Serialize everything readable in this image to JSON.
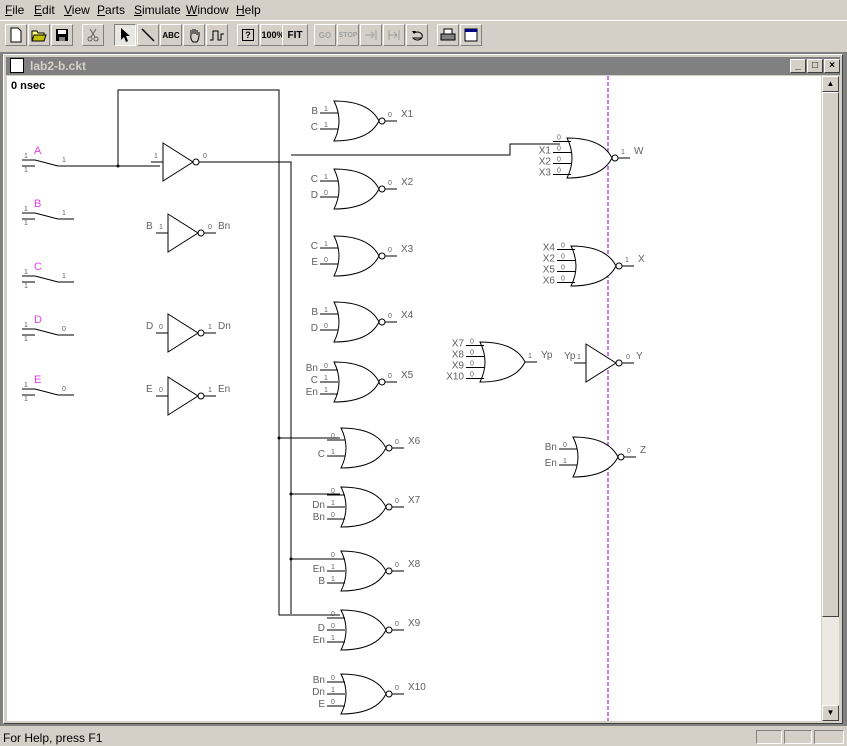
{
  "menu": {
    "file": "File",
    "edit": "Edit",
    "view": "View",
    "parts": "Parts",
    "simulate": "Simulate",
    "window": "Window",
    "help": "Help"
  },
  "toolbar": {
    "abc": "ABC",
    "q": "?",
    "zoom": "100%",
    "fit": "FIT",
    "go": "GO",
    "stop": "STOP"
  },
  "window": {
    "title": "lab2-b.ckt",
    "minimize": "_",
    "maximize": "□",
    "close": "×"
  },
  "time": "0 nsec",
  "status": {
    "text": "For Help, press F1"
  },
  "switches": [
    {
      "name": "A",
      "state": "1",
      "inbit": "1",
      "outbit": "1"
    },
    {
      "name": "B",
      "state": "1",
      "inbit": "1",
      "outbit": "1"
    },
    {
      "name": "C",
      "state": "1",
      "inbit": "1",
      "outbit": "1"
    },
    {
      "name": "D",
      "state": "1",
      "inbit": "1",
      "outbit": "0"
    },
    {
      "name": "E",
      "state": "1",
      "inbit": "1",
      "outbit": "0"
    }
  ],
  "inverters": [
    {
      "in": "",
      "inbit": "1",
      "out": "",
      "outbit": "0"
    },
    {
      "in": "B",
      "inbit": "1",
      "out": "Bn",
      "outbit": "0"
    },
    {
      "in": "D",
      "inbit": "0",
      "out": "Dn",
      "outbit": "1"
    },
    {
      "in": "E",
      "inbit": "0",
      "out": "En",
      "outbit": "1"
    },
    {
      "in": "Yp",
      "inbit": "1",
      "out": "Y",
      "outbit": "0"
    }
  ],
  "gates": [
    {
      "out": "X1",
      "outbit": "0",
      "ins": [
        {
          "n": "B",
          "b": "1"
        },
        {
          "n": "C",
          "b": "1"
        }
      ]
    },
    {
      "out": "X2",
      "outbit": "0",
      "ins": [
        {
          "n": "C",
          "b": "1"
        },
        {
          "n": "D",
          "b": "0"
        }
      ]
    },
    {
      "out": "X3",
      "outbit": "0",
      "ins": [
        {
          "n": "C",
          "b": "1"
        },
        {
          "n": "E",
          "b": "0"
        }
      ]
    },
    {
      "out": "X4",
      "outbit": "0",
      "ins": [
        {
          "n": "B",
          "b": "1"
        },
        {
          "n": "D",
          "b": "0"
        }
      ]
    },
    {
      "out": "X5",
      "outbit": "0",
      "ins": [
        {
          "n": "Bn",
          "b": "0"
        },
        {
          "n": "C",
          "b": "1"
        },
        {
          "n": "En",
          "b": "1"
        }
      ]
    },
    {
      "out": "X6",
      "outbit": "0",
      "ins": [
        {
          "n": "",
          "b": "0"
        },
        {
          "n": "C",
          "b": "1"
        }
      ]
    },
    {
      "out": "X7",
      "outbit": "0",
      "ins": [
        {
          "n": "",
          "b": "0"
        },
        {
          "n": "Dn",
          "b": "1"
        },
        {
          "n": "Bn",
          "b": "0"
        }
      ]
    },
    {
      "out": "X8",
      "outbit": "0",
      "ins": [
        {
          "n": "",
          "b": "0"
        },
        {
          "n": "En",
          "b": "1"
        },
        {
          "n": "B",
          "b": "1"
        }
      ]
    },
    {
      "out": "X9",
      "outbit": "0",
      "ins": [
        {
          "n": "",
          "b": "0"
        },
        {
          "n": "D",
          "b": "0"
        },
        {
          "n": "En",
          "b": "1"
        }
      ]
    },
    {
      "out": "X10",
      "outbit": "0",
      "ins": [
        {
          "n": "Bn",
          "b": "0"
        },
        {
          "n": "Dn",
          "b": "1"
        },
        {
          "n": "E",
          "b": "0"
        }
      ]
    },
    {
      "out": "W",
      "outbit": "1",
      "ins": [
        {
          "n": "",
          "b": "0"
        },
        {
          "n": "X1",
          "b": "0"
        },
        {
          "n": "X2",
          "b": "0"
        },
        {
          "n": "X3",
          "b": "0"
        }
      ]
    },
    {
      "out": "X",
      "outbit": "1",
      "ins": [
        {
          "n": "X4",
          "b": "0"
        },
        {
          "n": "X2",
          "b": "0"
        },
        {
          "n": "X5",
          "b": "0"
        },
        {
          "n": "X6",
          "b": "0"
        }
      ]
    },
    {
      "out": "Yp",
      "outbit": "1",
      "ins": [
        {
          "n": "X7",
          "b": "0"
        },
        {
          "n": "X8",
          "b": "0"
        },
        {
          "n": "X9",
          "b": "0"
        },
        {
          "n": "X10",
          "b": "0"
        }
      ]
    },
    {
      "out": "Z",
      "outbit": "0",
      "ins": [
        {
          "n": "Bn",
          "b": "0"
        },
        {
          "n": "En",
          "b": "1"
        }
      ]
    }
  ],
  "colors": {
    "accent": "#e040e0",
    "wire": "#000000",
    "label": "#606060",
    "timeline": "#8000c0"
  }
}
